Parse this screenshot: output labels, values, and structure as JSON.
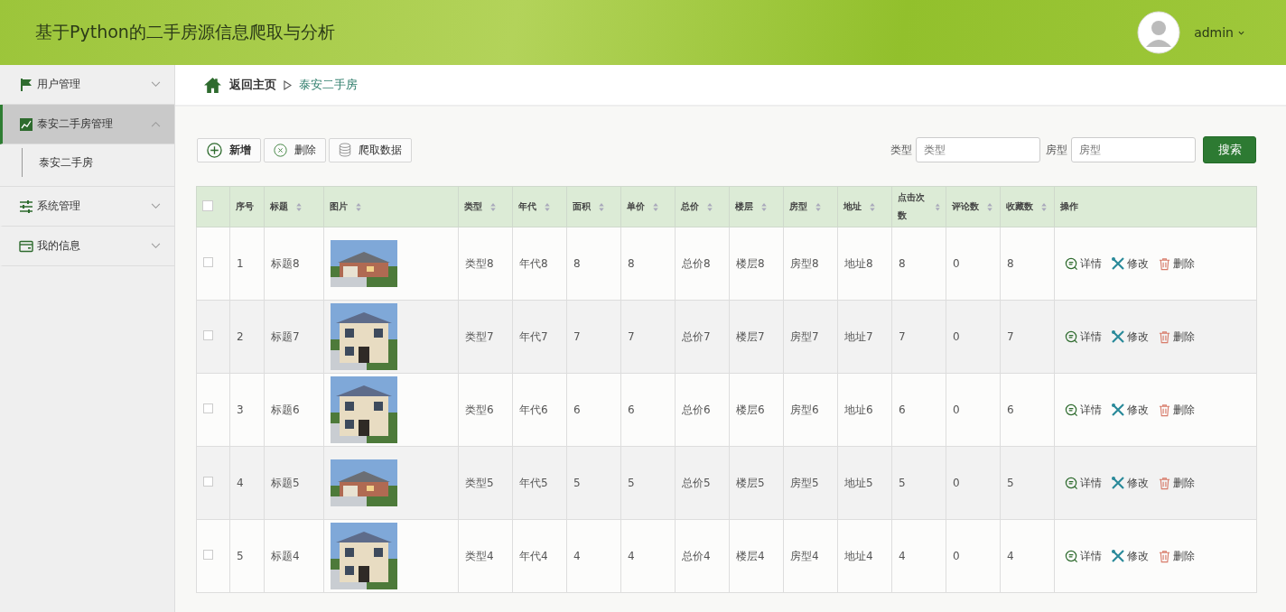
{
  "header": {
    "title": "基于Python的二手房源信息爬取与分析",
    "user": "admin"
  },
  "sidebar": [
    {
      "label": "用户管理",
      "selected": false,
      "expanded": false
    },
    {
      "label": "泰安二手房管理",
      "selected": true,
      "expanded": true,
      "children": [
        {
          "label": "泰安二手房",
          "selected": false
        }
      ]
    },
    {
      "label": "系统管理",
      "selected": false,
      "expanded": false
    },
    {
      "label": "我的信息",
      "selected": false,
      "expanded": false
    }
  ],
  "breadcrumb": {
    "home": "返回主页",
    "current": "泰安二手房"
  },
  "toolbar": [
    {
      "kind": "add",
      "label": "新增"
    },
    {
      "kind": "delete",
      "label": "删除"
    },
    {
      "kind": "crawl",
      "label": "爬取数据"
    }
  ],
  "search": {
    "fields": [
      {
        "label": "类型",
        "placeholder": "类型"
      },
      {
        "label": "房型",
        "placeholder": "房型"
      }
    ],
    "button": "搜索"
  },
  "table": {
    "all_checked": false,
    "columns": [
      {
        "label": "序号",
        "sortable": false,
        "kind": "text"
      },
      {
        "label": "标题",
        "sortable": true,
        "kind": "text"
      },
      {
        "label": "图片",
        "sortable": true,
        "kind": "picture"
      },
      {
        "label": "类型",
        "sortable": true,
        "kind": "text"
      },
      {
        "label": "年代",
        "sortable": true,
        "kind": "text"
      },
      {
        "label": "面积",
        "sortable": true,
        "kind": "text"
      },
      {
        "label": "单价",
        "sortable": true,
        "kind": "text"
      },
      {
        "label": "总价",
        "sortable": true,
        "kind": "text"
      },
      {
        "label": "楼层",
        "sortable": true,
        "kind": "text"
      },
      {
        "label": "房型",
        "sortable": true,
        "kind": "text"
      },
      {
        "label": "地址",
        "sortable": true,
        "kind": "text"
      },
      {
        "label": "点击次数",
        "sortable": true,
        "kind": "text"
      },
      {
        "label": "评论数",
        "sortable": true,
        "kind": "text"
      },
      {
        "label": "收藏数",
        "sortable": true,
        "kind": "text"
      },
      {
        "label": "操作",
        "sortable": false,
        "kind": "actions"
      }
    ],
    "rows": [
      {
        "checked": false,
        "cells": [
          "1",
          "标题8",
          "",
          "类型8",
          "年代8",
          "8",
          "8",
          "总价8",
          "楼层8",
          "房型8",
          "地址8",
          "8",
          "0",
          "8"
        ],
        "actions": [
          "详情",
          "修改",
          "删除"
        ]
      },
      {
        "checked": false,
        "cells": [
          "2",
          "标题7",
          "",
          "类型7",
          "年代7",
          "7",
          "7",
          "总价7",
          "楼层7",
          "房型7",
          "地址7",
          "7",
          "0",
          "7"
        ],
        "actions": [
          "详情",
          "修改",
          "删除"
        ]
      },
      {
        "checked": false,
        "cells": [
          "3",
          "标题6",
          "",
          "类型6",
          "年代6",
          "6",
          "6",
          "总价6",
          "楼层6",
          "房型6",
          "地址6",
          "6",
          "0",
          "6"
        ],
        "actions": [
          "详情",
          "修改",
          "删除"
        ]
      },
      {
        "checked": false,
        "cells": [
          "4",
          "标题5",
          "",
          "类型5",
          "年代5",
          "5",
          "5",
          "总价5",
          "楼层5",
          "房型5",
          "地址5",
          "5",
          "0",
          "5"
        ],
        "actions": [
          "详情",
          "修改",
          "删除"
        ]
      },
      {
        "checked": false,
        "cells": [
          "5",
          "标题4",
          "",
          "类型4",
          "年代4",
          "4",
          "4",
          "总价4",
          "楼层4",
          "房型4",
          "地址4",
          "4",
          "0",
          "4"
        ],
        "actions": [
          "详情",
          "修改",
          "删除"
        ]
      }
    ]
  }
}
